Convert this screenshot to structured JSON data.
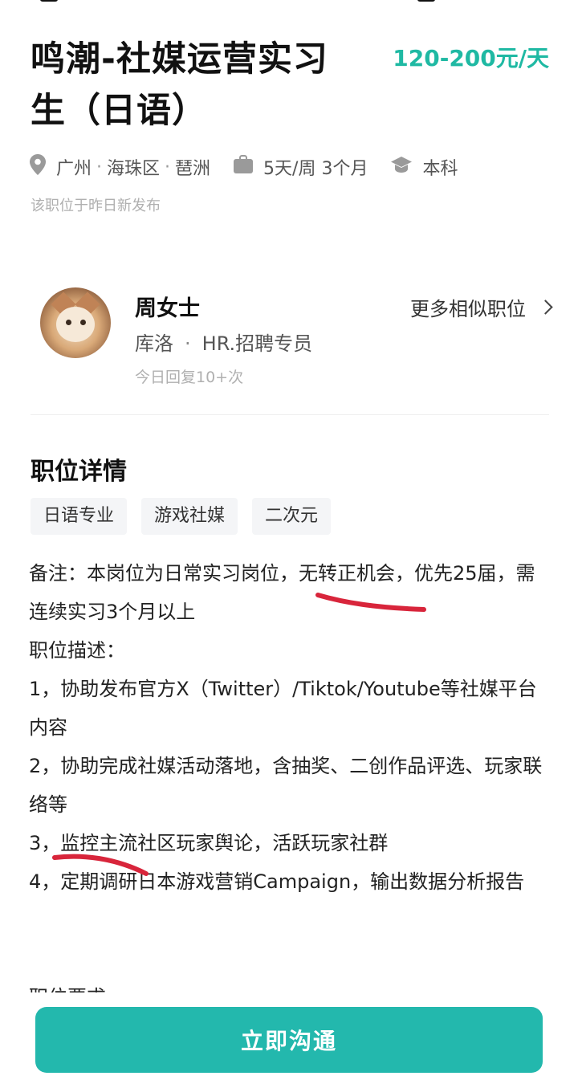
{
  "header": {
    "title": "鸣潮-社媒运营实习生（日语）",
    "salary": "120-200元/天"
  },
  "meta": {
    "location_city": "广州",
    "location_district": "海珠区",
    "location_area": "琶洲",
    "schedule": "5天/周 3个月",
    "education": "本科",
    "publish_note": "该职位于昨日新发布",
    "icons": {
      "location": "location-pin-icon",
      "schedule": "briefcase-icon",
      "education": "graduation-cap-icon"
    }
  },
  "hr": {
    "name": "周女士",
    "company": "库洛",
    "role": "HR.招聘专员",
    "reply_stat": "今日回复10+次",
    "more_similar": "更多相似职位"
  },
  "details": {
    "section_title": "职位详情",
    "tags": [
      "日语专业",
      "游戏社媒",
      "二次元"
    ],
    "lines": [
      "备注：本岗位为日常实习岗位，无转正机会，优先25届，需连续实习3个月以上",
      "职位描述：",
      "1，协助发布官方X（Twitter）/Tiktok/Youtube等社媒平台内容",
      "2，协助完成社媒活动落地，含抽奖、二创作品评选、玩家联络等",
      "3，监控主流社区玩家舆论，活跃玩家社群",
      "4，定期调研日本游戏营销Campaign，输出数据分析报告"
    ],
    "cut_off_heading": "职位要求"
  },
  "footer": {
    "chat_button": "立即沟通"
  },
  "colors": {
    "salary": "#1fb9a3",
    "button": "#23b8ad",
    "annotation_red": "#d8253b"
  }
}
